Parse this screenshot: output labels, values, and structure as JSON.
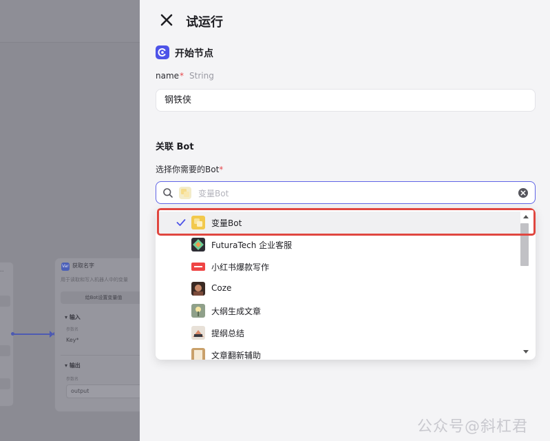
{
  "canvas": {
    "node_b": {
      "icon_text": "Var",
      "title": "获取名字",
      "description": "用于读取和写入机器人中的变量",
      "button": "给Bot设置变量值",
      "input_section": "输入",
      "input_sub": "参数名",
      "input_key": "Key*",
      "output_section": "输出",
      "output_sub": "参数名",
      "output_value": "output"
    },
    "node_a": {
      "dots": "..."
    }
  },
  "panel": {
    "title": "试运行",
    "start_node": "开始节点",
    "field": {
      "name": "name",
      "required": "*",
      "type": "String",
      "value": "钢铁侠"
    },
    "related_bot_title": "关联 Bot",
    "bot_label": "选择你需要的Bot",
    "bot_required": "*",
    "search_placeholder": "变量Bot",
    "options": [
      {
        "label": "变量Bot",
        "selected": true,
        "avatar_color": "#f2c94c"
      },
      {
        "label": "FuturaTech 企业客服",
        "selected": false,
        "avatar_color": "#6fcf97"
      },
      {
        "label": "小红书爆款写作",
        "selected": false,
        "avatar_color": "#ef4444"
      },
      {
        "label": "Coze",
        "selected": false,
        "avatar_color": "#7a4a3a"
      },
      {
        "label": "大纲生成文章",
        "selected": false,
        "avatar_color": "#a3b18a"
      },
      {
        "label": "提纲总结",
        "selected": false,
        "avatar_color": "#d98a6a"
      },
      {
        "label": "文章翻新辅助",
        "selected": false,
        "avatar_color": "#c9a06a"
      }
    ]
  },
  "watermark": "公众号@斜杠君",
  "colors": {
    "accent": "#4d53e8",
    "highlight": "#e0463f",
    "required": "#e5484d"
  }
}
